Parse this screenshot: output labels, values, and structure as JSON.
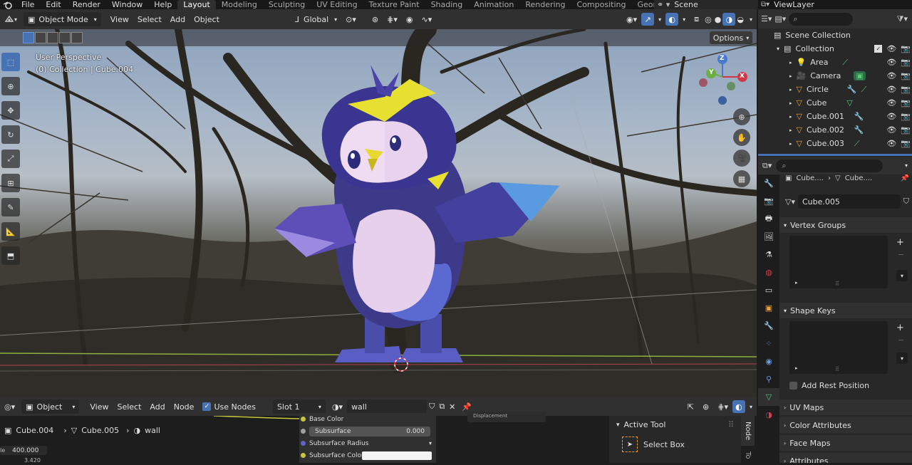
{
  "top_menu": {
    "items": [
      "File",
      "Edit",
      "Render",
      "Window",
      "Help"
    ],
    "workspaces": [
      "Layout",
      "Modeling",
      "Sculpting",
      "UV Editing",
      "Texture Paint",
      "Shading",
      "Animation",
      "Rendering",
      "Compositing",
      "Geometry Noc"
    ],
    "active_workspace": "Layout",
    "scene": "Scene",
    "view_layer": "ViewLayer"
  },
  "viewport_header": {
    "mode": "Object Mode",
    "menus": [
      "View",
      "Select",
      "Add",
      "Object"
    ],
    "orientation": "Global",
    "options": "Options"
  },
  "viewport": {
    "view_name": "User Perspective",
    "collection_info": "(0) Collection | Cube.004",
    "gizmo_labels": {
      "z": "Z",
      "y": "Y",
      "x": "X"
    }
  },
  "node_header": {
    "editor_type": "Object",
    "menus": [
      "View",
      "Select",
      "Add",
      "Node"
    ],
    "use_nodes": "Use Nodes",
    "slot": "Slot 1",
    "material": "wall"
  },
  "node_breadcrumb": {
    "object": "Cube.004",
    "mesh": "Cube.005",
    "material": "wall"
  },
  "node_values": {
    "left_value": "400.000",
    "left_value2": "3.420"
  },
  "node_panel": {
    "rows": [
      {
        "label": "Base Color"
      },
      {
        "label": "Subsurface",
        "value": "0.000"
      },
      {
        "label": "Subsurface Radius"
      },
      {
        "label": "Subsurface Color"
      }
    ],
    "top_fragment": "Displacement"
  },
  "sidebar_panel": {
    "title": "Active Tool",
    "tool": "Select Box",
    "tabs": [
      "Node",
      "To"
    ]
  },
  "outliner": {
    "root": "Scene Collection",
    "collection": "Collection",
    "items": [
      {
        "name": "Area",
        "icon": "light-icon"
      },
      {
        "name": "Camera",
        "icon": "camera-icon"
      },
      {
        "name": "Circle",
        "icon": "mesh-icon"
      },
      {
        "name": "Cube",
        "icon": "mesh-icon"
      },
      {
        "name": "Cube.001",
        "icon": "mesh-icon"
      },
      {
        "name": "Cube.002",
        "icon": "mesh-icon"
      },
      {
        "name": "Cube.003",
        "icon": "mesh-icon"
      }
    ]
  },
  "properties": {
    "breadcrumb": [
      "Cube....",
      "Cube...."
    ],
    "mesh_name": "Cube.005",
    "sections": [
      "Vertex Groups",
      "Shape Keys",
      "Add Rest Position",
      "UV Maps",
      "Color Attributes",
      "Face Maps",
      "Attributes"
    ]
  },
  "colors": {
    "accent": "#4772b3",
    "header": "#303030",
    "panel": "#282828",
    "bg": "#1d1d1d"
  }
}
